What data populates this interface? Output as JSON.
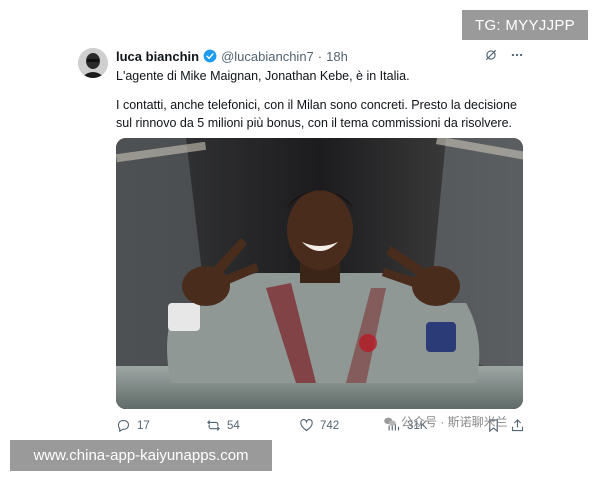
{
  "overlay": {
    "tg_label": "TG: MYYJJPP",
    "url_label": "www.china-app-kaiyunapps.com",
    "watermark_text": "公众号 · 斯诺聊米兰"
  },
  "tweet": {
    "author_name": "luca bianchin",
    "handle": "@lucabianchin7",
    "separator": "·",
    "time": "18h",
    "line1": "L'agente di Mike Maignan, Jonathan Kebe, è in Italia.",
    "line2": "I contatti, anche telefonici, con il Milan sono concreti. Presto la decisione sul rinnovo da 5 milioni più bonus, con il tema commissioni da risolvere.",
    "verified_color": "#1d9bf0"
  },
  "actions": {
    "replies": "17",
    "reposts": "54",
    "likes": "742",
    "views": "31K"
  }
}
